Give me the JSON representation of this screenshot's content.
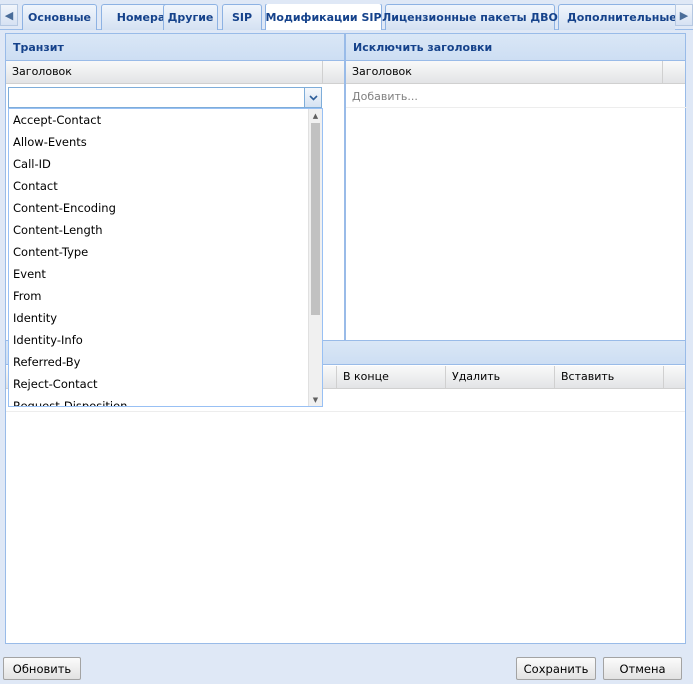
{
  "tabs": [
    {
      "label": "Основные"
    },
    {
      "label": "Номера"
    },
    {
      "label": "Другие"
    },
    {
      "label": "SIP"
    },
    {
      "label": "Модификации SIP",
      "active": true
    },
    {
      "label": "Лицензионные пакеты ДВО"
    },
    {
      "label": "Дополнительные у"
    }
  ],
  "transit": {
    "title": "Транзит",
    "column_header": "Заголовок",
    "combo_value": ""
  },
  "exclude": {
    "title": "Исключить заголовки",
    "column_header": "Заголовок",
    "add_placeholder": "Добавить..."
  },
  "second_grid": {
    "columns": [
      "В конце",
      "Удалить",
      "Вставить"
    ]
  },
  "dropdown": {
    "items": [
      "Accept-Contact",
      "Allow-Events",
      "Call-ID",
      "Contact",
      "Content-Encoding",
      "Content-Length",
      "Content-Type",
      "Event",
      "From",
      "Identity",
      "Identity-Info",
      "Referred-By",
      "Reject-Contact",
      "Request-Disposition"
    ],
    "scroll_position": 0.0
  },
  "footer": {
    "refresh_label": "Обновить",
    "save_label": "Сохранить",
    "cancel_label": "Отмена"
  },
  "icons": {
    "tab_scroll_left": "chevron-left-icon",
    "tab_scroll_right": "chevron-right-icon",
    "combo_trigger": "chevron-down-icon"
  },
  "colors": {
    "accent": "#15428b",
    "border": "#99bbe8",
    "background": "#dfe8f6"
  }
}
